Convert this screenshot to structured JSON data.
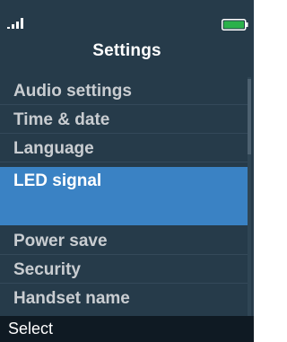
{
  "status_bar": {
    "signal_icon": "signal-strength-icon",
    "battery_icon": "battery-full-icon",
    "battery_color": "#2bb14a"
  },
  "title": "Settings",
  "menu": {
    "items": [
      {
        "label": "Audio settings",
        "selected": false
      },
      {
        "label": "Time & date",
        "selected": false
      },
      {
        "label": "Language",
        "selected": false
      },
      {
        "label": "LED signal",
        "selected": true
      },
      {
        "label": "Power save",
        "selected": false
      },
      {
        "label": "Security",
        "selected": false
      },
      {
        "label": "Handset name",
        "selected": false
      }
    ],
    "selection_color": "#3a82c4"
  },
  "softkeys": {
    "left": "Select"
  }
}
